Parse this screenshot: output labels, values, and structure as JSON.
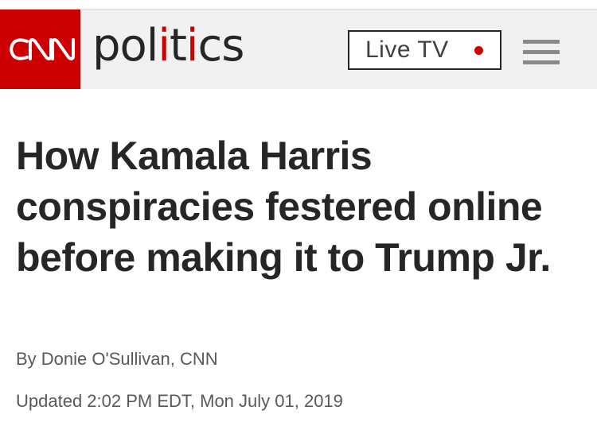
{
  "header": {
    "logo_text": "CNN",
    "section_parts": [
      "pol",
      "i",
      "t",
      "i",
      "cs"
    ],
    "live_tv_label": "Live TV",
    "menu_icon": "hamburger-menu-icon",
    "brand_color": "#cc0000",
    "header_background": "#f1f1f1"
  },
  "article": {
    "headline": "How Kamala Harris conspiracies festered online before making it to Trump Jr.",
    "byline": "By Donie O'Sullivan, CNN",
    "timestamp": "Updated 2:02 PM EDT, Mon July 01, 2019"
  }
}
